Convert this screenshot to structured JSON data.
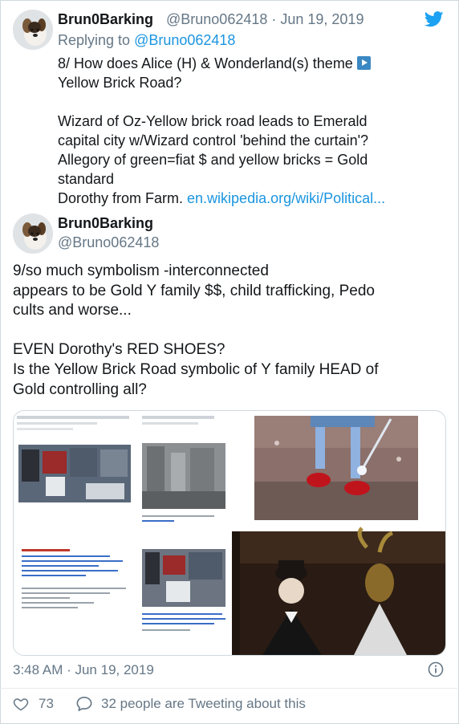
{
  "tweet1": {
    "display_name": "Brun0Barking",
    "handle_date": "@Bruno062418 · Jun 19, 2019",
    "replying_prefix": "Replying to ",
    "replying_handle": "@Bruno062418",
    "lines": [
      "8/ How does Alice (H)  & Wonderland(s) theme ",
      "Yellow Brick Road?",
      "Wizard of Oz-Yellow brick road leads to Emerald",
      "capital city w/Wizard control 'behind the curtain'?",
      "Allegory of green=fiat $ and yellow bricks = Gold",
      "standard",
      "Dorothy from Farm. "
    ],
    "link_text": "en.wikipedia.org/wiki/Political..."
  },
  "tweet2": {
    "display_name": "Brun0Barking",
    "handle": "@Bruno062418",
    "lines": [
      "9/so much symbolism -interconnected",
      "appears to be Gold Y family $$, child trafficking, Pedo",
      "cults and worse...",
      "EVEN Dorothy's RED SHOES?",
      "Is the Yellow Brick Road symbolic of Y family HEAD of",
      "Gold controlling all?"
    ],
    "time": "3:48 AM · Jun 19, 2019",
    "likes": "73",
    "conversation": "32 people are Tweeting about this"
  },
  "icons": {
    "brand": "twitter-bird-icon",
    "info": "info-icon",
    "like": "heart-icon",
    "comment": "speech-bubble-icon",
    "emoji": "play-button-emoji"
  },
  "colors": {
    "twitter_blue": "#1da1f2",
    "link": "#1b95e0",
    "muted": "#657786",
    "text": "#14171a"
  }
}
